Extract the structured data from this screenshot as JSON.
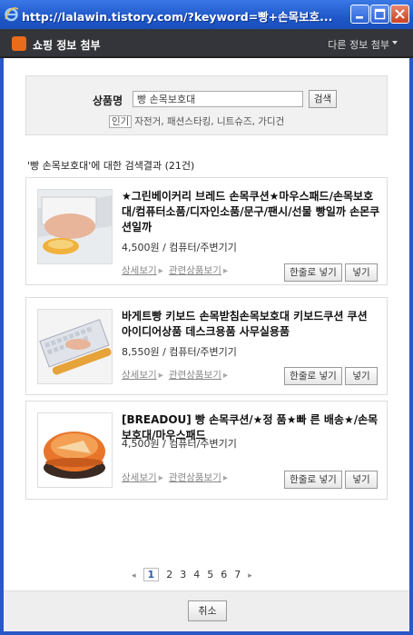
{
  "window": {
    "title": "http://lalawin.tistory.com/?keyword=빵+손목보호..."
  },
  "header": {
    "title": "쇼핑 정보 첨부",
    "other_menu": "다른 정보 첨부"
  },
  "search": {
    "label": "상품명",
    "value": "빵 손목보호대",
    "button": "검색",
    "popular_tag": "인기",
    "popular_text": "자전거, 패션스타킹, 니트슈즈, 가디건"
  },
  "results": {
    "summary": "'빵 손목보호대'에 대한 검색결과 (21건)",
    "items": [
      {
        "name": "★그린베이커리 브레드 손목쿠션★마우스패드/손목보호대/컴퓨터소품/디자인소품/문구/팬시/선물 빵일까 손몬쿠션일까",
        "price": "4,500원 / 컴퓨터/주변기기",
        "detail": "상세보기",
        "related": "관련상품보기",
        "insert_one": "한줄로 넣기",
        "insert": "넣기"
      },
      {
        "name": "바게트빵 키보드 손목받침손목보호대 키보드쿠션 쿠션 아이디어상품 데스크용품 사무실용품",
        "price": "8,550원 / 컴퓨터/주변기기",
        "detail": "상세보기",
        "related": "관련상품보기",
        "insert_one": "한줄로 넣기",
        "insert": "넣기"
      },
      {
        "name": "[BREADOU] 빵 손목쿠션/★정 품★빠 른 배송★/손목보호대/마우스패드",
        "price": "4,500원 / 컴퓨터/주변기기",
        "detail": "상세보기",
        "related": "관련상품보기",
        "insert_one": "한줄로 넣기",
        "insert": "넣기"
      }
    ]
  },
  "pagination": {
    "current": "1",
    "pages": [
      "2",
      "3",
      "4",
      "5",
      "6",
      "7"
    ]
  },
  "footer": {
    "cancel": "취소"
  },
  "colors": {
    "titlebar": "#2157cb",
    "header_bg": "#34353a",
    "logo": "#e86c1a",
    "page_active": "#2c5eb0"
  }
}
